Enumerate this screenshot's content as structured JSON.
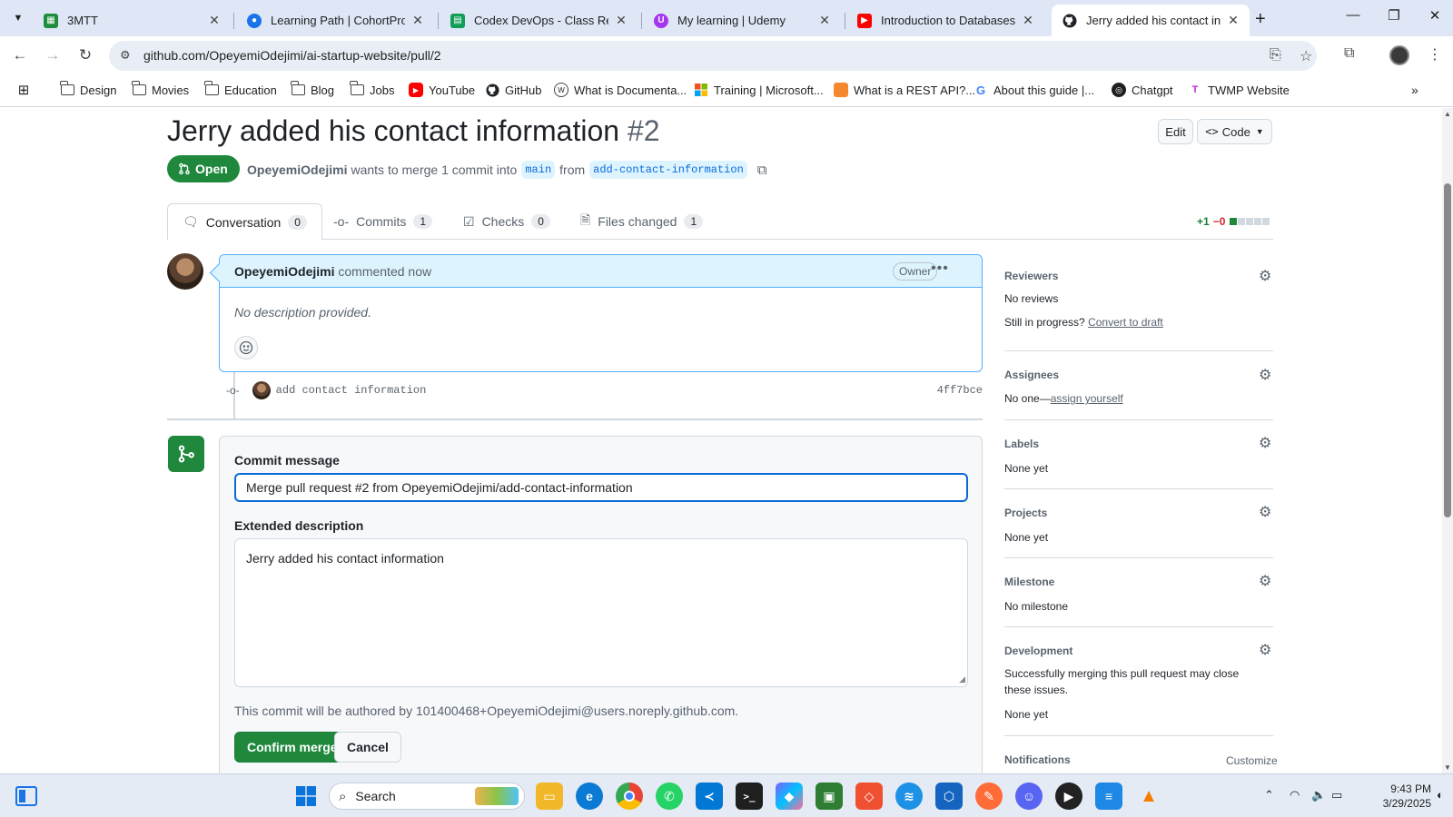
{
  "browser": {
    "tabs": [
      {
        "title": "3MTT",
        "icon": "3mtt-icon",
        "color": "#1e8e3e"
      },
      {
        "title": "Learning Path | CohortProject",
        "icon": "cohortproject-icon",
        "color": "#1a73e8"
      },
      {
        "title": "Codex DevOps - Class Record",
        "icon": "google-sheets-icon",
        "color": "#0f9d58"
      },
      {
        "title": "My learning | Udemy",
        "icon": "udemy-icon",
        "color": "#a435f0"
      },
      {
        "title": "Introduction to Databases for",
        "icon": "youtube-icon",
        "color": "#ff0000"
      },
      {
        "title": "Jerry added his contact information",
        "icon": "github-icon",
        "color": "#1f2328",
        "active": true
      }
    ],
    "url": "github.com/OpeyemiOdejimi/ai-startup-website/pull/2",
    "bookmarks": [
      {
        "label": "Design",
        "icon": "folder-icon"
      },
      {
        "label": "Movies",
        "icon": "folder-icon"
      },
      {
        "label": "Education",
        "icon": "folder-icon"
      },
      {
        "label": "Blog",
        "icon": "folder-icon"
      },
      {
        "label": "Jobs",
        "icon": "folder-icon"
      },
      {
        "label": "YouTube",
        "icon": "youtube-icon"
      },
      {
        "label": "GitHub",
        "icon": "github-icon"
      },
      {
        "label": "What is Documenta...",
        "icon": "docs-icon"
      },
      {
        "label": "Training | Microsoft...",
        "icon": "microsoft-icon"
      },
      {
        "label": "What is a REST API?...",
        "icon": "orange-square-icon"
      },
      {
        "label": "About this guide  |...",
        "icon": "google-icon"
      },
      {
        "label": "Chatgpt",
        "icon": "chatgpt-icon"
      },
      {
        "label": "TWMP Website",
        "icon": "twmp-icon"
      }
    ]
  },
  "pr": {
    "title": "Jerry added his contact information",
    "number": "#2",
    "edit_label": "Edit",
    "code_label": "Code",
    "state": "Open",
    "author": "OpeyemiOdejimi",
    "merge_text": "wants to merge 1 commit into",
    "base_branch": "main",
    "from_text": "from",
    "head_branch": "add-contact-information",
    "tabs": [
      {
        "label": "Conversation",
        "count": "0"
      },
      {
        "label": "Commits",
        "count": "1"
      },
      {
        "label": "Checks",
        "count": "0"
      },
      {
        "label": "Files changed",
        "count": "1"
      }
    ],
    "diff_add": "+1",
    "diff_del": "−0"
  },
  "comment": {
    "author": "OpeyemiOdejimi",
    "when": "commented now",
    "badge": "Owner",
    "body": "No description provided."
  },
  "commit": {
    "message": "add contact information",
    "sha": "4ff7bce"
  },
  "merge": {
    "commit_label": "Commit message",
    "commit_value": "Merge pull request #2 from OpeyemiOdejimi/add-contact-information",
    "ext_label": "Extended description",
    "ext_value": "Jerry added his contact information",
    "author_line": "This commit will be authored by 101400468+OpeyemiOdejimi@users.noreply.github.com.",
    "confirm_label": "Confirm merge",
    "cancel_label": "Cancel"
  },
  "sidebar": {
    "reviewers": {
      "title": "Reviewers",
      "value": "No reviews",
      "progress": "Still in progress?",
      "draft_link": "Convert to draft"
    },
    "assignees": {
      "title": "Assignees",
      "value": "No one—",
      "link": "assign yourself"
    },
    "labels": {
      "title": "Labels",
      "value": "None yet"
    },
    "projects": {
      "title": "Projects",
      "value": "None yet"
    },
    "milestone": {
      "title": "Milestone",
      "value": "No milestone"
    },
    "development": {
      "title": "Development",
      "desc": "Successfully merging this pull request may close these issues.",
      "value": "None yet"
    },
    "notifications": {
      "title": "Notifications",
      "action": "Customize"
    }
  },
  "taskbar": {
    "search_placeholder": "Search",
    "time": "9:43 PM",
    "date": "3/29/2025"
  },
  "colors": {
    "accent_green": "#1f883d",
    "link_blue": "#0969da",
    "comment_header": "#ddf4ff"
  }
}
